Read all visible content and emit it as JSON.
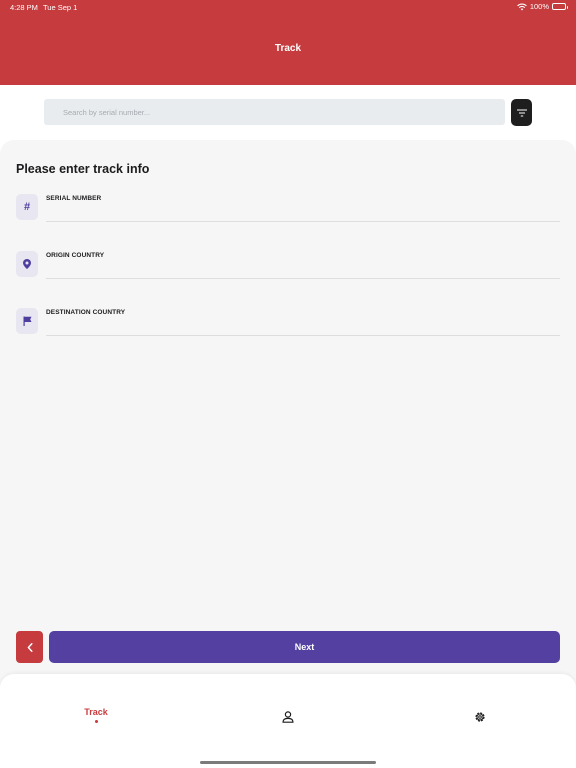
{
  "status_bar": {
    "time": "4:28 PM",
    "date": "Tue Sep 1",
    "battery": "100%"
  },
  "header": {
    "title": "Track"
  },
  "search": {
    "placeholder": "Search by serial number...",
    "value": ""
  },
  "form": {
    "title": "Please enter track info",
    "fields": [
      {
        "label": "SERIAL NUMBER",
        "icon": "hash-icon"
      },
      {
        "label": "ORIGIN COUNTRY",
        "icon": "map-pin-icon"
      },
      {
        "label": "DESTINATION COUNTRY",
        "icon": "flag-icon"
      }
    ]
  },
  "actions": {
    "back_icon": "chevron-left-icon",
    "next_label": "Next"
  },
  "tabs": [
    {
      "label": "Track",
      "active": true
    },
    {
      "icon": "user-icon"
    },
    {
      "icon": "gear-icon"
    }
  ],
  "colors": {
    "primary_red": "#c63b3e",
    "accent_purple": "#5340a1",
    "icon_tint": "#4e3f9e"
  }
}
